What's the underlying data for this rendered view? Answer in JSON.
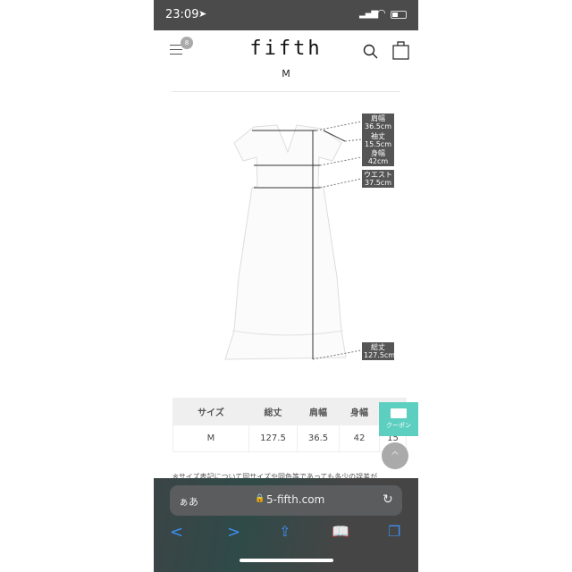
{
  "status_bar": {
    "time": "23:09"
  },
  "header": {
    "logo": "fifth",
    "menu_badge": "8",
    "selected_size": "M"
  },
  "measurements": [
    {
      "name": "肩幅",
      "value": "36.5cm"
    },
    {
      "name": "袖丈",
      "value": "15.5cm"
    },
    {
      "name": "身幅",
      "value": "42cm"
    },
    {
      "name": "ウエスト",
      "value": "37.5cm"
    },
    {
      "name": "総丈",
      "value": "127.5cm"
    }
  ],
  "size_table": {
    "headers": [
      "サイズ",
      "総丈",
      "肩幅",
      "身幅",
      "袖丈"
    ],
    "rows": [
      [
        "M",
        "127.5",
        "36.5",
        "42",
        "15"
      ]
    ]
  },
  "coupon_label": "クーポン",
  "note": "※サイズ表記について同サイズや同色等であっても多少の誤差が",
  "browser": {
    "text_size": "ぁあ",
    "url": "5-fifth.com"
  },
  "colors": {
    "coupon": "#5ccfc0",
    "toolbar_icon": "#3d8ef0"
  }
}
